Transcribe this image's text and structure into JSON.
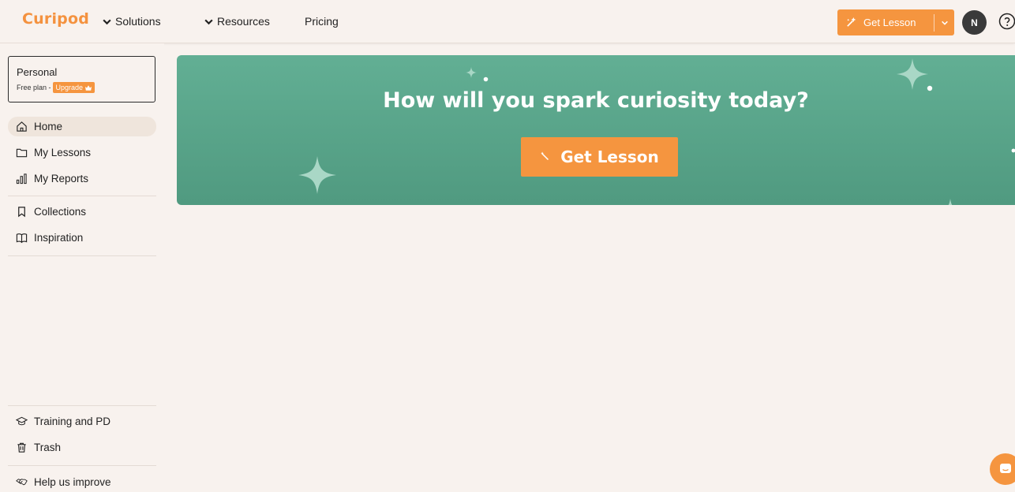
{
  "app": {
    "logo": "Curipod",
    "accent": "#f5953f",
    "hero_color": "#5aa58a"
  },
  "topnav": {
    "solutions": "Solutions",
    "resources": "Resources",
    "pricing": "Pricing",
    "get_lesson": "Get Lesson",
    "avatar_initial": "N",
    "help_icon": "question-circle-icon"
  },
  "sidebar": {
    "workspace_name": "Personal",
    "plan": "Free plan -",
    "upgrade": "Upgrade",
    "items": [
      {
        "label": "Home",
        "icon": "home-icon"
      },
      {
        "label": "My Lessons",
        "icon": "folder-icon"
      },
      {
        "label": "My Reports",
        "icon": "bar-chart-icon"
      },
      {
        "label": "Collections",
        "icon": "bookmark-icon"
      },
      {
        "label": "Inspiration",
        "icon": "book-open-icon"
      }
    ],
    "bottom_items": [
      {
        "label": "Training and PD",
        "icon": "graduation-cap-icon"
      },
      {
        "label": "Trash",
        "icon": "trash-icon"
      },
      {
        "label": "Help us improve",
        "icon": "handshake-icon"
      }
    ]
  },
  "hero": {
    "title": "How will you spark curiosity today?",
    "button": "Get Lesson"
  }
}
